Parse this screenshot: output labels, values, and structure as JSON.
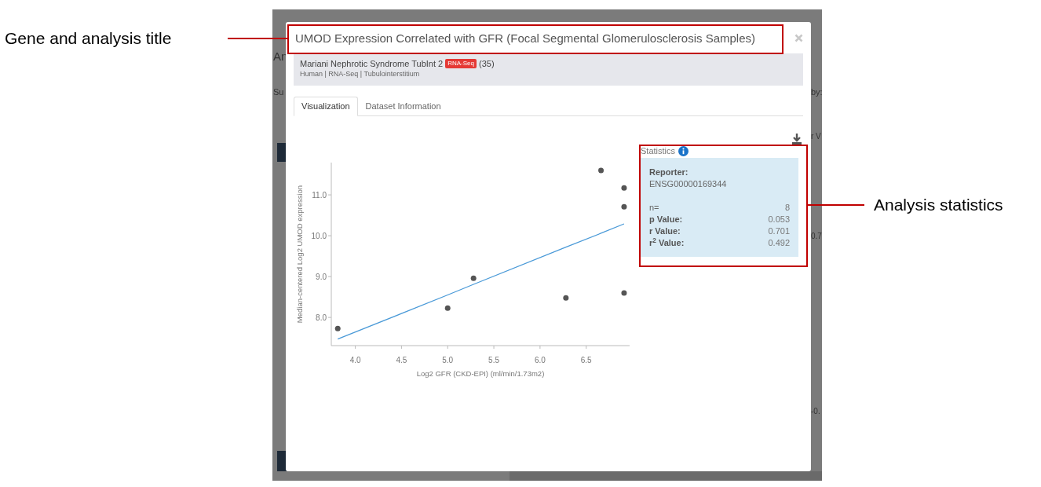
{
  "annotations": [
    {
      "label": "Gene and analysis title"
    },
    {
      "label": "Analysis statistics"
    }
  ],
  "background": {
    "fragments": [
      "An",
      "Su",
      "by:",
      "r V",
      "0.7",
      "-0."
    ]
  },
  "modal": {
    "title": "UMOD Expression Correlated with GFR (Focal Segmental Glomerulosclerosis Samples)",
    "dataset": {
      "name": "Mariani Nephrotic Syndrome TubInt 2",
      "badge": "RNA-Seq",
      "count": "(35)",
      "meta": "Human | RNA-Seq | Tubulointerstitium"
    },
    "tabs": [
      {
        "label": "Visualization",
        "selected": true
      },
      {
        "label": "Dataset Information",
        "selected": false
      }
    ],
    "chart_data": {
      "type": "scatter",
      "xlabel": "Log2 GFR (CKD-EPI) (ml/min/1.73m2)",
      "ylabel": "Median-centered Log2 UMOD expression",
      "x": [
        3.81,
        5.0,
        5.28,
        6.28,
        6.66,
        6.91,
        6.91,
        6.91
      ],
      "series": [
        {
          "color": "#555555",
          "values": [
            7.73,
            8.23,
            8.96,
            8.48,
            11.6,
            11.17,
            10.71,
            8.6
          ]
        },
        {
          "type": "line",
          "color": "#4a9ad8",
          "values": [
            7.47,
            8.55,
            8.81,
            9.72,
            10.06,
            10.29,
            10.29,
            10.29
          ]
        }
      ],
      "xlim": [
        3.74,
        6.97
      ],
      "ylim": [
        7.31,
        11.79
      ],
      "xticks": [
        {
          "value": 4,
          "label": "4.0"
        },
        {
          "value": 4.5,
          "label": "4.5"
        },
        {
          "value": 5,
          "label": "5.0"
        },
        {
          "value": 5.5,
          "label": "5.5"
        },
        {
          "value": 6,
          "label": "6.0"
        },
        {
          "value": 6.5,
          "label": "6.5"
        }
      ],
      "yticks": [
        {
          "value": 8,
          "label": "8.0"
        },
        {
          "value": 9,
          "label": "9.0"
        },
        {
          "value": 10,
          "label": "10.0"
        },
        {
          "value": 11,
          "label": "11.0"
        }
      ]
    },
    "statistics": {
      "title": "Statistics",
      "reporter_label": "Reporter:",
      "reporter": "ENSG00000169344",
      "rows": [
        {
          "label": "n=",
          "value": "8",
          "bold": false
        },
        {
          "label": "p Value:",
          "value": "0.053",
          "bold": true
        },
        {
          "label": "r Value:",
          "value": "0.701",
          "bold": true
        },
        {
          "label": "r$^{2}$ Value:",
          "value": "0.492",
          "bold": true
        }
      ]
    }
  }
}
